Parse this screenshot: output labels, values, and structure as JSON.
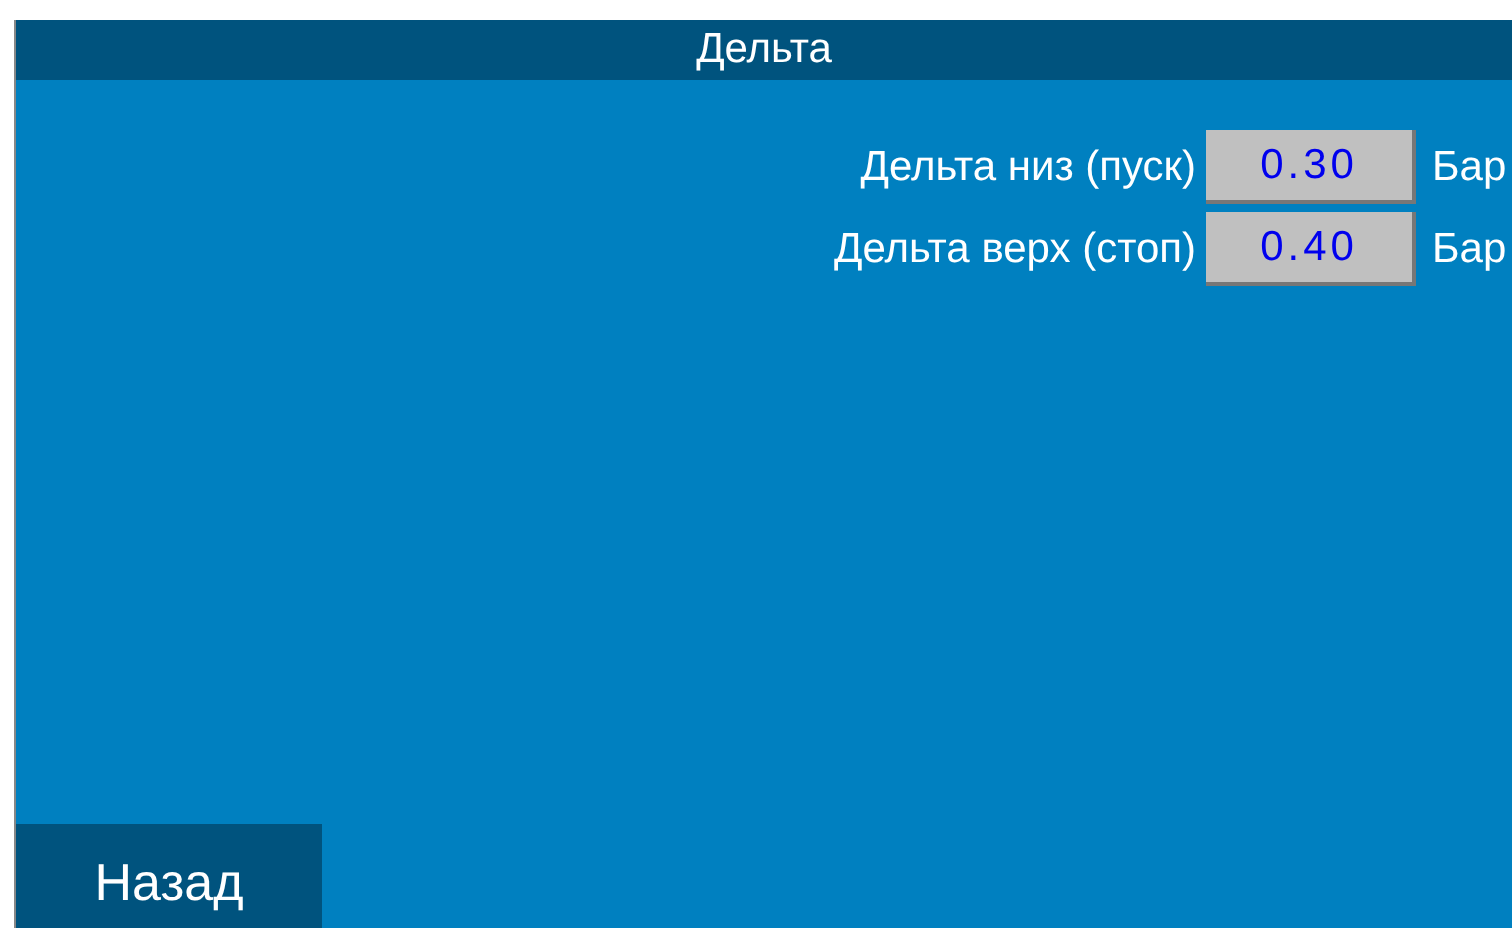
{
  "header": {
    "title": "Дельта"
  },
  "parameters": [
    {
      "label": "Дельта низ (пуск)",
      "value": "0.30",
      "unit": "Бар"
    },
    {
      "label": "Дельта верх (стоп)",
      "value": "0.40",
      "unit": "Бар"
    }
  ],
  "back_button": {
    "label": "Назад"
  }
}
